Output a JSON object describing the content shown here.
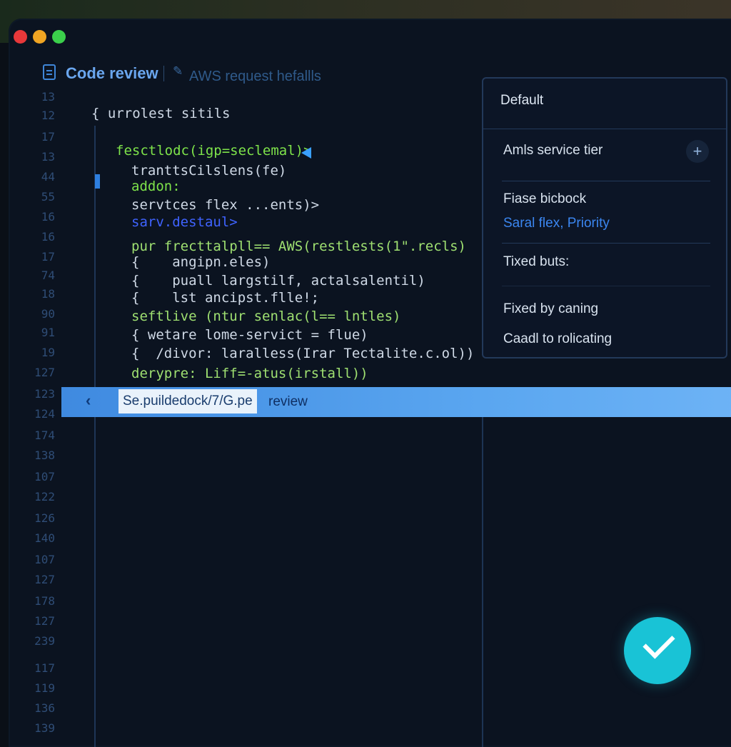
{
  "window": {
    "title": "Code review",
    "breadcrumb": "AWS request hefallls"
  },
  "gutter": [
    "13",
    "12",
    "17",
    "13",
    "44",
    "55",
    "16",
    "16",
    "17",
    "74",
    "18",
    "90",
    "91",
    "19",
    "127",
    "123",
    "124",
    "174",
    "138",
    "107",
    "122",
    "126",
    "140",
    "107",
    "127",
    "178",
    "127",
    "239",
    "117",
    "119",
    "136",
    "139"
  ],
  "code": {
    "header": "{ urrolest sitils",
    "lines": [
      "fesctlodc(igp=seclemal)>",
      "tranttsCilslens(fe)",
      "addon:",
      "servtces flex ...ents)>",
      "sarv.destaul>",
      "pur frecttalpll== AWS(restlests(1\".recls)",
      "{    angipn.eles)",
      "{    puall largstilf, actalsalentil)",
      "{    lst ancipst.flle!;",
      "seftlive (ntur senlac(l== lntles)",
      "{ wetare lome-servict = flue)",
      "{  /divor: laralless(Irar Tectalite.c.ol))",
      "derypre: Liff=-atus(irstall))"
    ]
  },
  "highlight": {
    "path": "Se.puildedock/7/G.pe",
    "suffix": "review"
  },
  "panel": {
    "header": "Default",
    "tier_label": "Amls service tier",
    "plus": "+",
    "fiase_label": "Fiase bicbock",
    "fiase_link": "Saral flex, Priority",
    "tixed_label": "Tixed buts:",
    "fixed_label": "Fixed by caning",
    "caadl_label": "Caadl to rolicating"
  },
  "colors": {
    "accent": "#19c3d6",
    "highlight_bar": "#4f9ae8",
    "code_green": "#7ee34a",
    "code_blue": "#3f63ff",
    "link_blue": "#3b86f0"
  },
  "icons": {
    "doc": "doc-icon",
    "edit": "pencil-icon",
    "back": "chevron-left-icon",
    "plus": "plus-icon",
    "confirm": "check-icon"
  }
}
